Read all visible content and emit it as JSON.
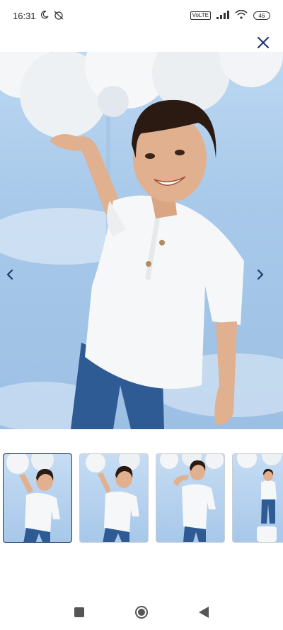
{
  "status_bar": {
    "time": "16:31",
    "volte_label": "VoLTE",
    "battery_level": "46"
  },
  "gallery": {
    "selected_index": 0,
    "image_count": 4
  },
  "colors": {
    "accent": "#1f3b6d",
    "sky": "#a8c9ea",
    "shirt": "#f6f7f8",
    "jeans": "#2f5b94",
    "hair": "#2a1a12",
    "skin": "#e1b08f"
  },
  "icons": {
    "close": "close-icon",
    "prev": "chevron-left-icon",
    "next": "chevron-right-icon",
    "home": "home-icon",
    "back": "back-icon",
    "recents": "recents-icon"
  }
}
